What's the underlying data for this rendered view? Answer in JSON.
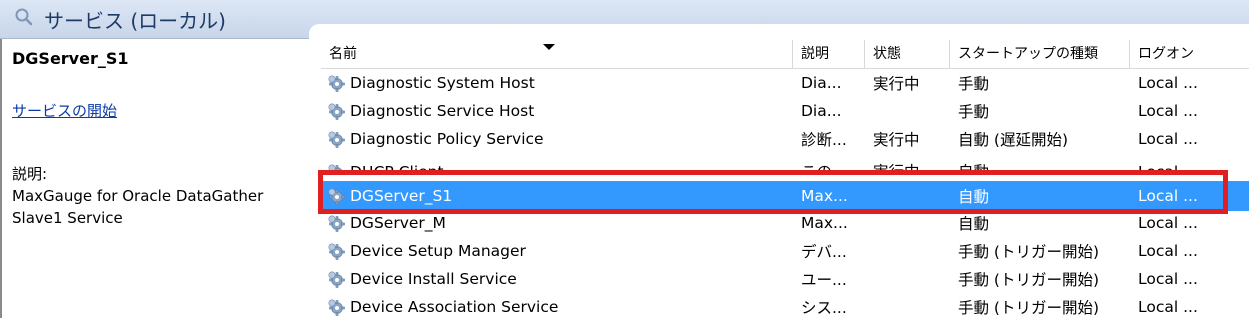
{
  "header": {
    "title": "サービス (ローカル)",
    "icon": "search-icon"
  },
  "left_pane": {
    "service_name": "DGServer_S1",
    "start_link": "サービスの開始",
    "desc_label": "説明:",
    "desc_text": "MaxGauge for Oracle DataGather Slave1 Service"
  },
  "columns": {
    "name": "名前",
    "desc": "説明",
    "state": "状態",
    "startup": "スタートアップの種類",
    "logon": "ログオン"
  },
  "rows": [
    {
      "name": "Diagnostic System Host",
      "desc": "Dia...",
      "state": "実行中",
      "startup": "手動",
      "logon": "Local ..."
    },
    {
      "name": "Diagnostic Service Host",
      "desc": "Dia...",
      "state": "",
      "startup": "手動",
      "logon": "Local ..."
    },
    {
      "name": "Diagnostic Policy Service",
      "desc": "診断...",
      "state": "実行中",
      "startup": "自動 (遅延開始)",
      "logon": "Local ..."
    },
    {
      "name": "DHCP Client",
      "desc": "この...",
      "state": "実行中",
      "startup": "自動",
      "logon": "Local ..."
    },
    {
      "name": "DGServer_S1",
      "desc": "Max...",
      "state": "",
      "startup": "自動",
      "logon": "Local ..."
    },
    {
      "name": "DGServer_M",
      "desc": "Max...",
      "state": "",
      "startup": "自動",
      "logon": "Local ..."
    },
    {
      "name": "Device Setup Manager",
      "desc": "デバ...",
      "state": "",
      "startup": "手動 (トリガー開始)",
      "logon": "Local ..."
    },
    {
      "name": "Device Install Service",
      "desc": "ユー...",
      "state": "",
      "startup": "手動 (トリガー開始)",
      "logon": "Local ..."
    },
    {
      "name": "Device Association Service",
      "desc": "シス...",
      "state": "",
      "startup": "手動 (トリガー開始)",
      "logon": "Local ..."
    }
  ],
  "colors": {
    "selection": "#3399ff",
    "highlight": "#e02020",
    "link": "#0a3ba8"
  }
}
